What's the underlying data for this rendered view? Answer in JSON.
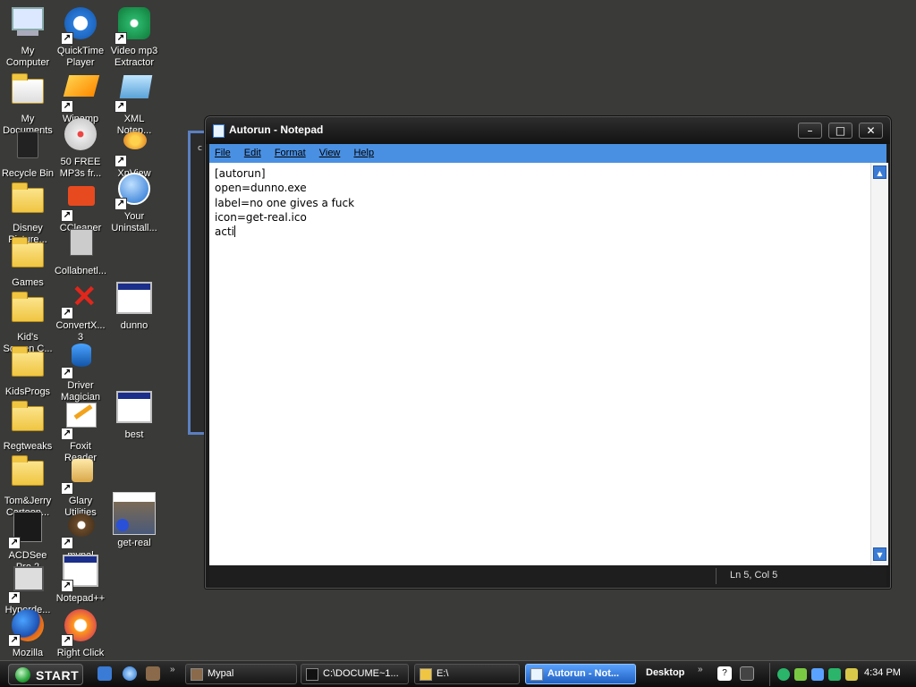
{
  "desktop": {
    "icons": [
      {
        "label": "My Computer",
        "icon": "my-computer-icon"
      },
      {
        "label": "QuickTime Player",
        "icon": "quicktime-icon"
      },
      {
        "label": "Video mp3 Extractor",
        "icon": "video-mp3-extractor-icon"
      },
      {
        "label": "My Documents",
        "icon": "my-documents-icon"
      },
      {
        "label": "Winamp",
        "icon": "winamp-icon"
      },
      {
        "label": "XML Notep...",
        "icon": "xml-notepad-icon"
      },
      {
        "label": "Recycle Bin",
        "icon": "recycle-bin-icon"
      },
      {
        "label": "50 FREE MP3s fr...",
        "icon": "mp3s-icon"
      },
      {
        "label": "XnView",
        "icon": "xnview-icon"
      },
      {
        "label": "Disney Picture...",
        "icon": "folder-icon"
      },
      {
        "label": "CCleaner",
        "icon": "ccleaner-icon"
      },
      {
        "label": "Your Uninstall...",
        "icon": "your-uninstaller-icon"
      },
      {
        "label": "Games",
        "icon": "folder-icon"
      },
      {
        "label": "Collabnetl...",
        "icon": "collabnet-icon"
      },
      {
        "label": "Kid's Screen C...",
        "icon": "folder-icon"
      },
      {
        "label": "ConvertX... 3",
        "icon": "convertx-icon"
      },
      {
        "label": "dunno",
        "icon": "window-app-icon"
      },
      {
        "label": "KidsProgs",
        "icon": "folder-icon"
      },
      {
        "label": "Driver Magician",
        "icon": "driver-magician-icon"
      },
      {
        "label": "Regtweaks",
        "icon": "folder-icon"
      },
      {
        "label": "Foxit Reader",
        "icon": "foxit-reader-icon"
      },
      {
        "label": "best",
        "icon": "window-app-icon"
      },
      {
        "label": "Tom&Jerry Cartoon...",
        "icon": "folder-icon"
      },
      {
        "label": "Glary Utilities",
        "icon": "glary-utilities-icon"
      },
      {
        "label": "ACDSee Pro 2",
        "icon": "acdsee-icon"
      },
      {
        "label": "mypal",
        "icon": "mypal-icon"
      },
      {
        "label": "get-real",
        "icon": "image-thumbnail-icon"
      },
      {
        "label": "Hyperde...",
        "icon": "hyperdesk-icon"
      },
      {
        "label": "Notepad++",
        "icon": "notepadpp-icon"
      },
      {
        "label": "Mozilla",
        "icon": "firefox-icon"
      },
      {
        "label": "Right Click",
        "icon": "right-click-icon"
      }
    ],
    "bg_window_letter": "c"
  },
  "notepad": {
    "title": "Autorun - Notepad",
    "buttons": {
      "minimize": "–",
      "maximize": "□",
      "close": "✕"
    },
    "menu": [
      "File",
      "Edit",
      "Format",
      "View",
      "Help"
    ],
    "lines": [
      "[autorun]",
      "open=dunno.exe",
      "label=no one gives a fuck",
      "icon=get-real.ico",
      "acti"
    ],
    "status": "Ln 5, Col 5",
    "scroll_up": "▲",
    "scroll_down": "▼"
  },
  "taskbar": {
    "start_label": "START",
    "chevron": "»",
    "tasks": [
      {
        "label": "Mypal",
        "icon": "mypal-icon"
      },
      {
        "label": "C:\\DOCUME~1...",
        "icon": "cmd-icon"
      },
      {
        "label": "E:\\",
        "icon": "explorer-icon"
      },
      {
        "label": "Autorun - Not...",
        "icon": "notepad-icon"
      }
    ],
    "desktop_toolbar": "Desktop",
    "clock": "4:34 PM"
  },
  "colors": {
    "desktop_bg": "#3a3a38",
    "menu_bar": "#4a90e2",
    "active_task": "#3a86f0"
  }
}
